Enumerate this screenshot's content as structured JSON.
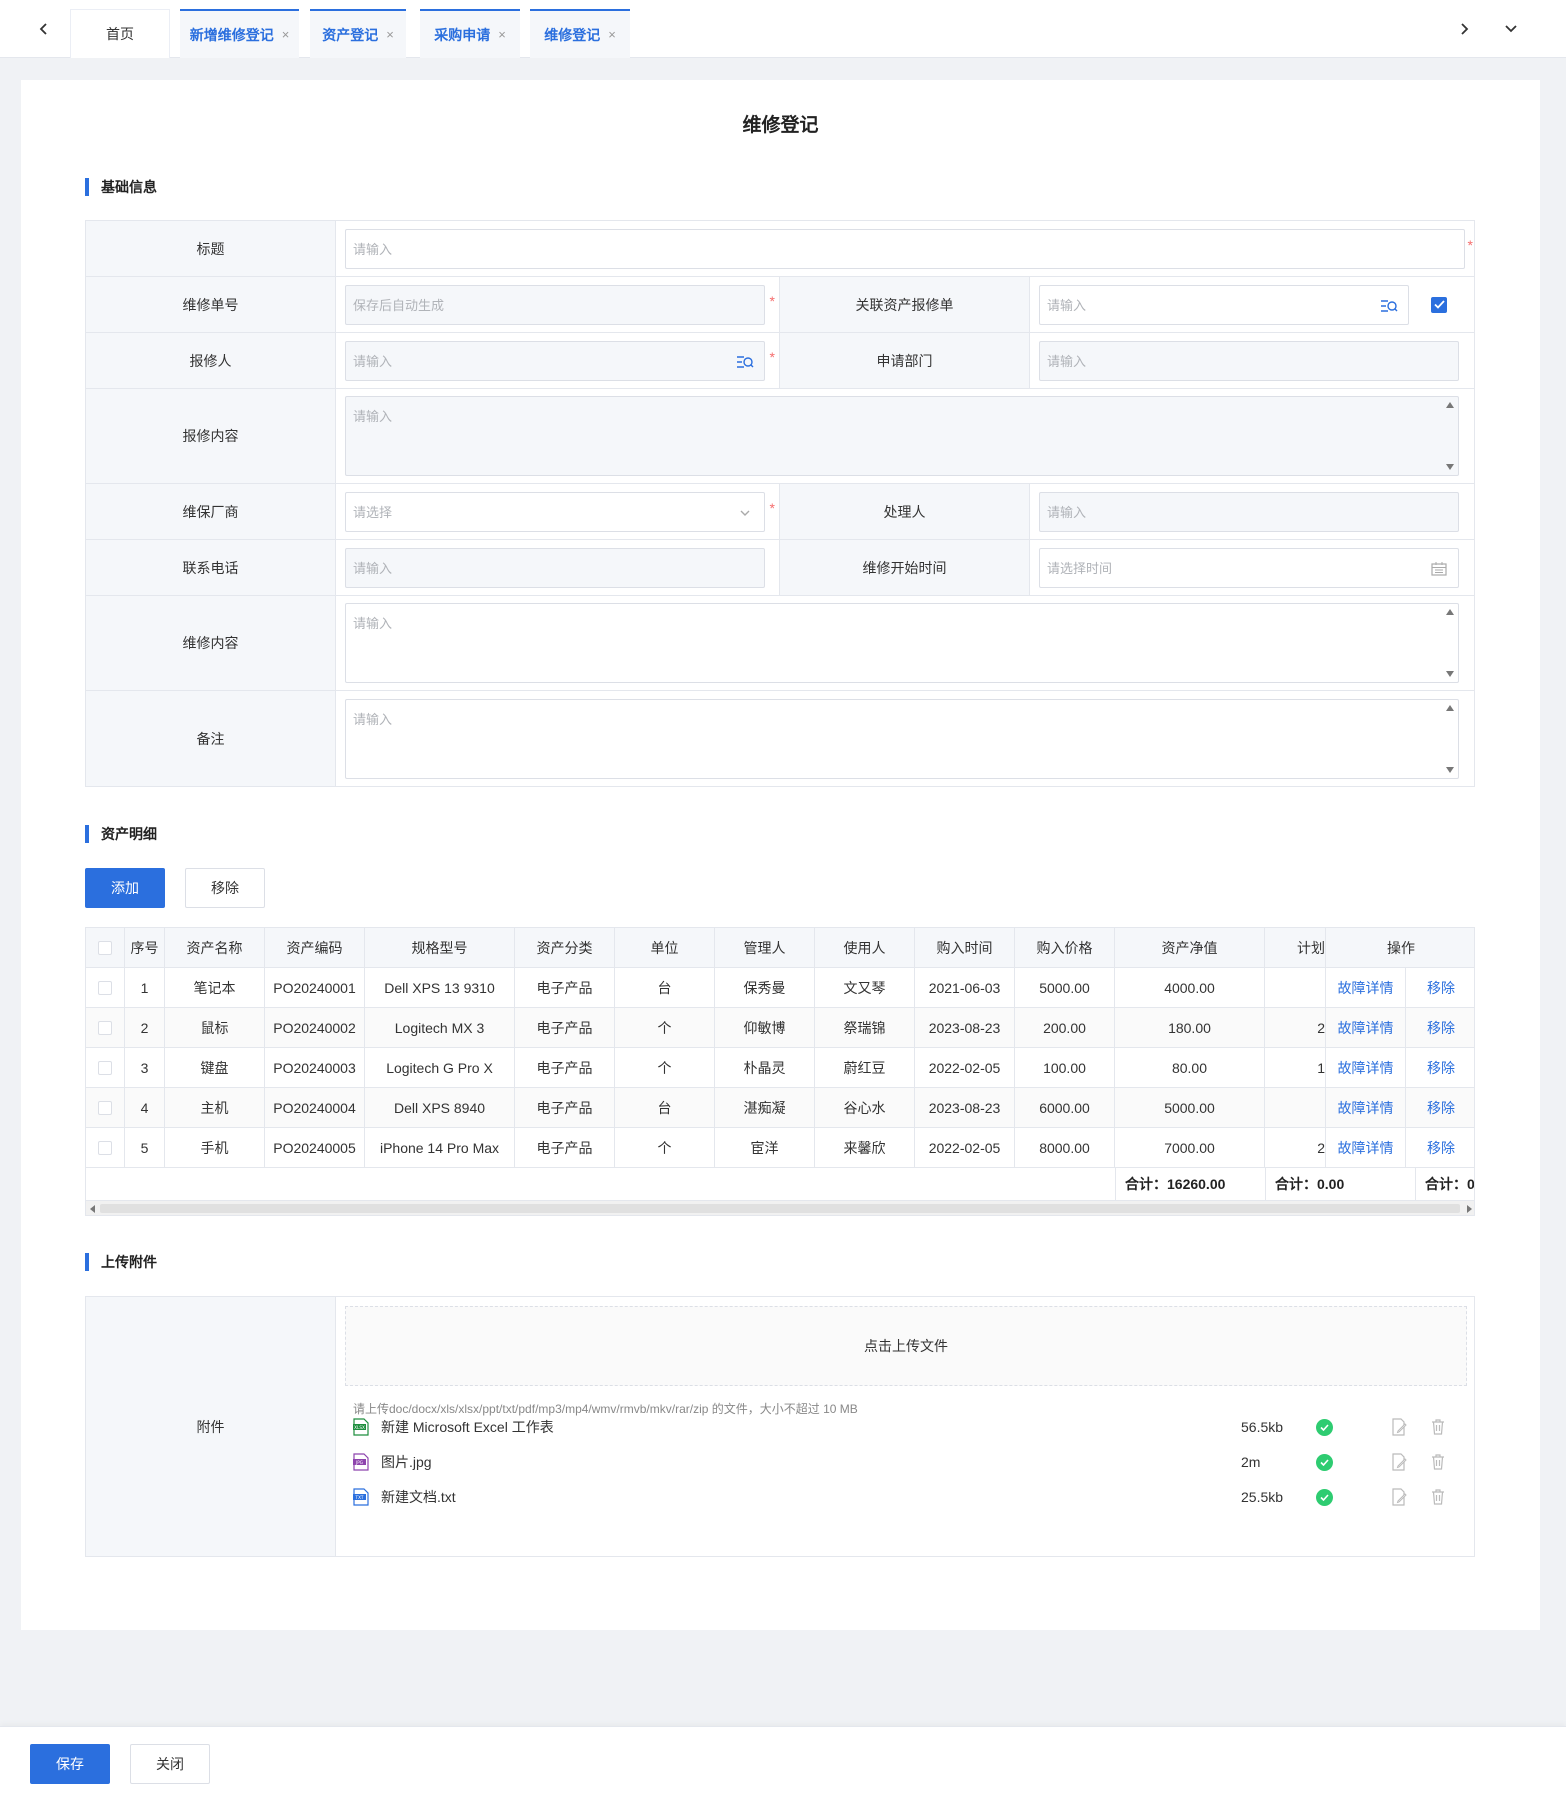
{
  "tabs": [
    {
      "label": "首页"
    },
    {
      "label": "新增维修登记",
      "close": "×"
    },
    {
      "label": "资产登记",
      "close": "×"
    },
    {
      "label": "采购申请",
      "close": "×"
    },
    {
      "label": "维修登记",
      "close": "×"
    }
  ],
  "page": {
    "title": "维修登记"
  },
  "sections": {
    "basic": "基础信息",
    "assets": "资产明细",
    "upload": "上传附件"
  },
  "form": {
    "title_label": "标题",
    "title_placeholder": "请输入",
    "repair_no_label": "维修单号",
    "repair_no_placeholder": "保存后自动生成",
    "related_label": "关联资产报修单",
    "related_placeholder": "请输入",
    "related_checked": true,
    "reporter_label": "报修人",
    "reporter_placeholder": "请输入",
    "dept_label": "申请部门",
    "dept_placeholder": "请输入",
    "report_content_label": "报修内容",
    "report_content_placeholder": "请输入",
    "vendor_label": "维保厂商",
    "vendor_placeholder": "请选择",
    "handler_label": "处理人",
    "handler_placeholder": "请输入",
    "phone_label": "联系电话",
    "phone_placeholder": "请输入",
    "start_time_label": "维修开始时间",
    "start_time_placeholder": "请选择时间",
    "repair_content_label": "维修内容",
    "repair_content_placeholder": "请输入",
    "remark_label": "备注",
    "remark_placeholder": "请输入",
    "required_mark": "*"
  },
  "asset_buttons": {
    "add": "添加",
    "remove": "移除"
  },
  "table": {
    "headers": [
      "序号",
      "资产名称",
      "资产编码",
      "规格型号",
      "资产分类",
      "单位",
      "管理人",
      "使用人",
      "购入时间",
      "购入价格",
      "资产净值",
      "计划",
      "操作"
    ],
    "rows": [
      {
        "no": "1",
        "name": "笔记本",
        "code": "PO20240001",
        "model": "Dell XPS 13 9310",
        "category": "电子产品",
        "unit": "台",
        "manager": "保秀曼",
        "user": "文又琴",
        "date": "2021-06-03",
        "price": "5000.00",
        "net": "4000.00",
        "plan": "",
        "detail": "故障详情",
        "remove": "移除"
      },
      {
        "no": "2",
        "name": "鼠标",
        "code": "PO20240002",
        "model": "Logitech MX  3",
        "category": "电子产品",
        "unit": "个",
        "manager": "仰敏博",
        "user": "祭瑞锦",
        "date": "2023-08-23",
        "price": "200.00",
        "net": "180.00",
        "plan": "2",
        "detail": "故障详情",
        "remove": "移除"
      },
      {
        "no": "3",
        "name": "键盘",
        "code": "PO20240003",
        "model": "Logitech G Pro X",
        "category": "电子产品",
        "unit": "个",
        "manager": "朴晶灵",
        "user": "蔚红豆",
        "date": "2022-02-05",
        "price": "100.00",
        "net": "80.00",
        "plan": "1",
        "detail": "故障详情",
        "remove": "移除"
      },
      {
        "no": "4",
        "name": "主机",
        "code": "PO20240004",
        "model": "Dell XPS 8940",
        "category": "电子产品",
        "unit": "台",
        "manager": "湛痴凝",
        "user": "谷心水",
        "date": "2023-08-23",
        "price": "6000.00",
        "net": "5000.00",
        "plan": "",
        "detail": "故障详情",
        "remove": "移除"
      },
      {
        "no": "5",
        "name": "手机",
        "code": "PO20240005",
        "model": "iPhone 14 Pro Max",
        "category": "电子产品",
        "unit": "个",
        "manager": "宦洋",
        "user": "来馨欣",
        "date": "2022-02-05",
        "price": "8000.00",
        "net": "7000.00",
        "plan": "2",
        "detail": "故障详情",
        "remove": "移除"
      }
    ],
    "totals": [
      "合计：16260.00",
      "合计：0.00",
      "合计：0"
    ]
  },
  "upload": {
    "label": "附件",
    "drop_text": "点击上传文件",
    "hint": "请上传doc/docx/xls/xlsx/ppt/txt/pdf/mp3/mp4/wmv/rmvb/mkv/rar/zip 的文件，大小不超过 10 MB",
    "files": [
      {
        "name": "新建 Microsoft Excel 工作表",
        "size": "56.5kb",
        "icon": "xlsx-file-icon",
        "icon_text": "XLSX",
        "color": "#1e8e3e"
      },
      {
        "name": "图片.jpg",
        "size": "2m",
        "icon": "jpg-file-icon",
        "icon_text": "JPG",
        "color": "#8e44ad"
      },
      {
        "name": "新建文档.txt",
        "size": "25.5kb",
        "icon": "txt-file-icon",
        "icon_text": "TXT",
        "color": "#2b6fde"
      }
    ]
  },
  "footer": {
    "save": "保存",
    "close": "关闭"
  },
  "colors": {
    "primary": "#2b6fde",
    "success": "#2ecc71",
    "required": "#f56c6c"
  }
}
